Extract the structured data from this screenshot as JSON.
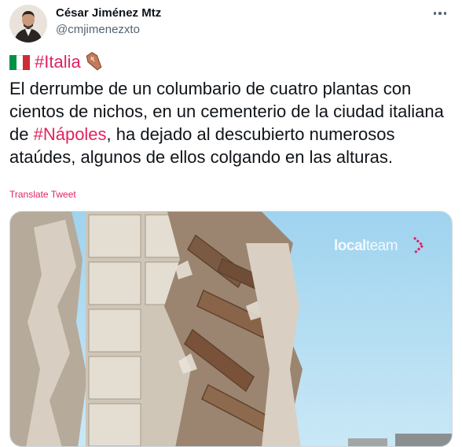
{
  "author": {
    "display_name": "César Jiménez Mtz",
    "handle": "@cmjimenezxto"
  },
  "tweet": {
    "hashtag_italia": "#Italia",
    "text_part1": "El derrumbe de un columbario de cuatro plantas con cientos de nichos, en un cementerio de la ciudad italiana de ",
    "hashtag_napoles": "#Nápoles",
    "text_part2": ", ha dejado al descubierto numerosos ataúdes, algunos de ellos colgando en las alturas.",
    "translate_label": "Translate Tweet"
  },
  "media": {
    "watermark_bold": "local",
    "watermark_light": "team"
  },
  "icons": {
    "flag": "italy-flag-icon",
    "coffin": "coffin-icon",
    "more": "more-options-icon",
    "watermark_arrow": "chevron-arrow-icon"
  },
  "colors": {
    "hashtag": "#e0245e",
    "secondary_text": "#536471",
    "flag_green": "#009246",
    "flag_white": "#ffffff",
    "flag_red": "#ce2b37"
  }
}
